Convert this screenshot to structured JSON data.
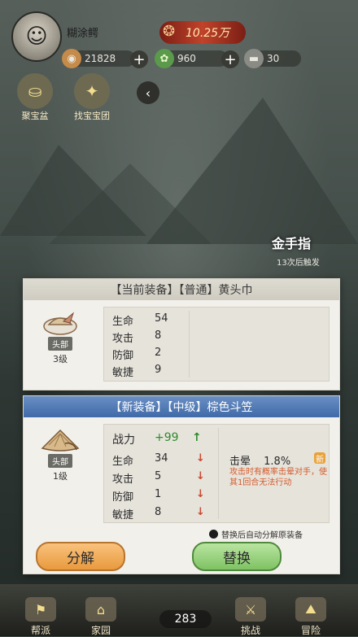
{
  "header": {
    "player_name": "糊涂鳄",
    "combat_power": "10.25万",
    "resources": [
      {
        "name": "gold",
        "icon": "coin-icon",
        "value": "21828"
      },
      {
        "name": "jade",
        "icon": "jade-icon",
        "value": "960"
      },
      {
        "name": "stamina",
        "icon": "scroll-icon",
        "value": "30"
      }
    ]
  },
  "quick": [
    {
      "label": "聚宝盆",
      "icon": "treasure-bowl-icon"
    },
    {
      "label": "找宝宝团",
      "icon": "gift-icon"
    }
  ],
  "scene": {
    "skill_name": "金手指",
    "skill_note": "13次后触发"
  },
  "current_equip": {
    "title": "【当前装备】【普通】黄头巾",
    "slot": "头部",
    "level": "3级",
    "stats": [
      {
        "label": "生命",
        "value": "54"
      },
      {
        "label": "攻击",
        "value": "8"
      },
      {
        "label": "防御",
        "value": "2"
      },
      {
        "label": "敏捷",
        "value": "9"
      }
    ]
  },
  "new_equip": {
    "title": "【新装备】【中级】棕色斗笠",
    "slot": "头部",
    "level": "1级",
    "power_label": "战力",
    "power_delta": "+99",
    "stats": [
      {
        "label": "生命",
        "value": "34"
      },
      {
        "label": "攻击",
        "value": "5"
      },
      {
        "label": "防御",
        "value": "1"
      },
      {
        "label": "敏捷",
        "value": "8"
      }
    ],
    "special": {
      "name": "击晕",
      "value": "1.8%",
      "desc": "攻击时有概率击晕对手，使其1回合无法行动"
    },
    "auto_decompose": "替换后自动分解原装备"
  },
  "buttons": {
    "decompose": "分解",
    "replace": "替换"
  },
  "bottom_nav": [
    {
      "label": "帮派",
      "icon": "clan-icon"
    },
    {
      "label": "家园",
      "icon": "home-icon"
    },
    {
      "label": "挑战",
      "icon": "challenge-icon"
    },
    {
      "label": "冒险",
      "icon": "adventure-icon"
    }
  ],
  "bottom_counter": "283",
  "colors": {
    "new_header": "#3f6aa8",
    "increase": "#2d8a2d",
    "decrease": "#c84a30",
    "stun_note": "#d65a2a"
  }
}
